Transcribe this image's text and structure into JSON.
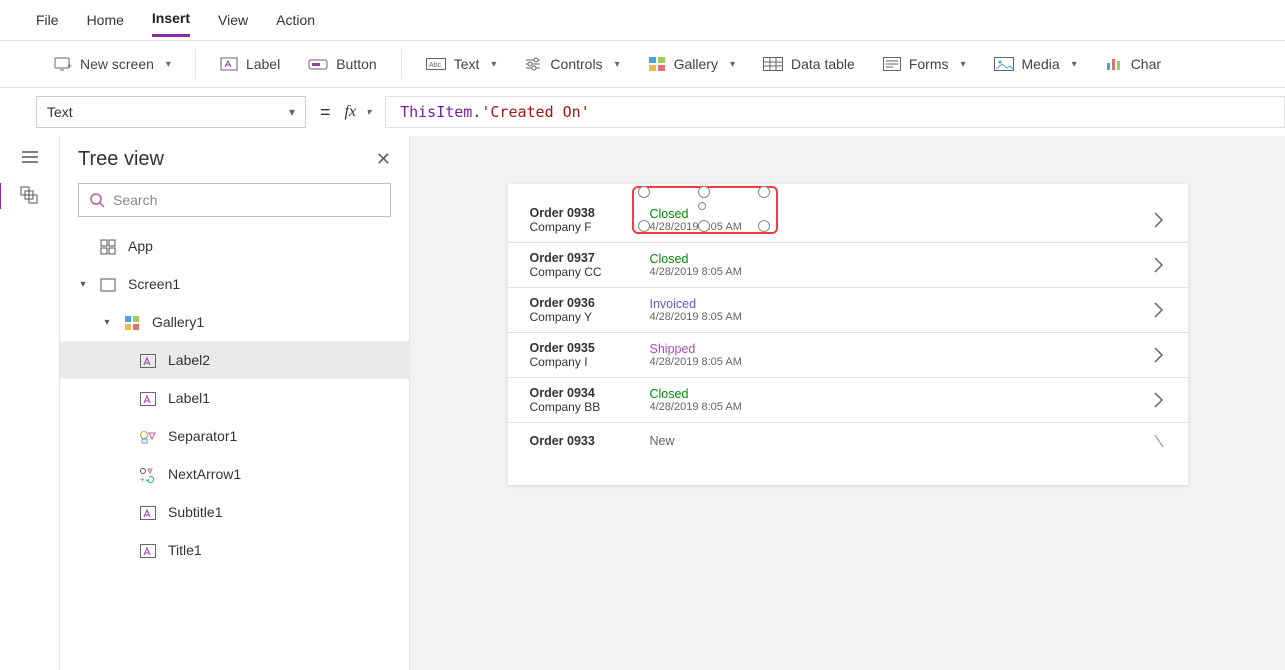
{
  "menubar": {
    "items": [
      "File",
      "Home",
      "Insert",
      "View",
      "Action"
    ],
    "active": 2
  },
  "ribbon": {
    "newScreen": "New screen",
    "label": "Label",
    "button": "Button",
    "text": "Text",
    "controls": "Controls",
    "gallery": "Gallery",
    "dataTable": "Data table",
    "forms": "Forms",
    "media": "Media",
    "charts": "Char"
  },
  "formulaBar": {
    "property": "Text",
    "formulaObj": "ThisItem",
    "formulaDot": ".",
    "formulaStr": "'Created On'"
  },
  "treeView": {
    "title": "Tree view",
    "searchPlaceholder": "Search",
    "nodes": {
      "app": "App",
      "screen1": "Screen1",
      "gallery1": "Gallery1",
      "items": [
        "Label2",
        "Label1",
        "Separator1",
        "NextArrow1",
        "Subtitle1",
        "Title1"
      ]
    },
    "selected": "Label2"
  },
  "gallery": [
    {
      "order": "Order 0938",
      "company": "Company F",
      "status": "Closed",
      "date": "4/28/2019 8:05 AM"
    },
    {
      "order": "Order 0937",
      "company": "Company CC",
      "status": "Closed",
      "date": "4/28/2019 8:05 AM"
    },
    {
      "order": "Order 0936",
      "company": "Company Y",
      "status": "Invoiced",
      "date": "4/28/2019 8:05 AM"
    },
    {
      "order": "Order 0935",
      "company": "Company I",
      "status": "Shipped",
      "date": "4/28/2019 8:05 AM"
    },
    {
      "order": "Order 0934",
      "company": "Company BB",
      "status": "Closed",
      "date": "4/28/2019 8:05 AM"
    },
    {
      "order": "Order 0933",
      "company": "",
      "status": "New",
      "date": ""
    }
  ]
}
